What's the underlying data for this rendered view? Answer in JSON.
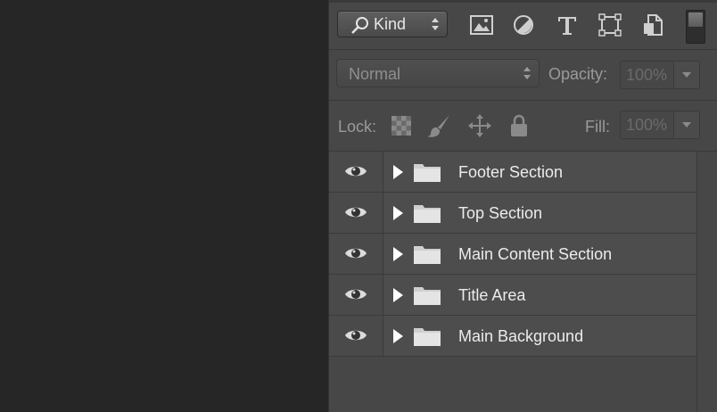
{
  "filter_bar": {
    "kind_label": "Kind",
    "icons": [
      "search-icon",
      "image-icon",
      "adjustment-icon",
      "type-icon",
      "shape-icon",
      "smart-object-icon"
    ]
  },
  "blend": {
    "mode": "Normal",
    "opacity_label": "Opacity:",
    "opacity_value": "100%"
  },
  "lock": {
    "lock_label": "Lock:",
    "fill_label": "Fill:",
    "fill_value": "100%",
    "icons": [
      "lock-transparent-pixels-icon",
      "lock-image-pixels-icon",
      "lock-position-icon",
      "lock-all-icon"
    ]
  },
  "layers": [
    {
      "name": "Footer Section"
    },
    {
      "name": "Top Section"
    },
    {
      "name": "Main Content Section"
    },
    {
      "name": "Title Area"
    },
    {
      "name": "Main Background"
    }
  ],
  "colors": {
    "canvas_bg": "#262626",
    "panel_bg": "#474747",
    "layer_text": "#ececec"
  }
}
